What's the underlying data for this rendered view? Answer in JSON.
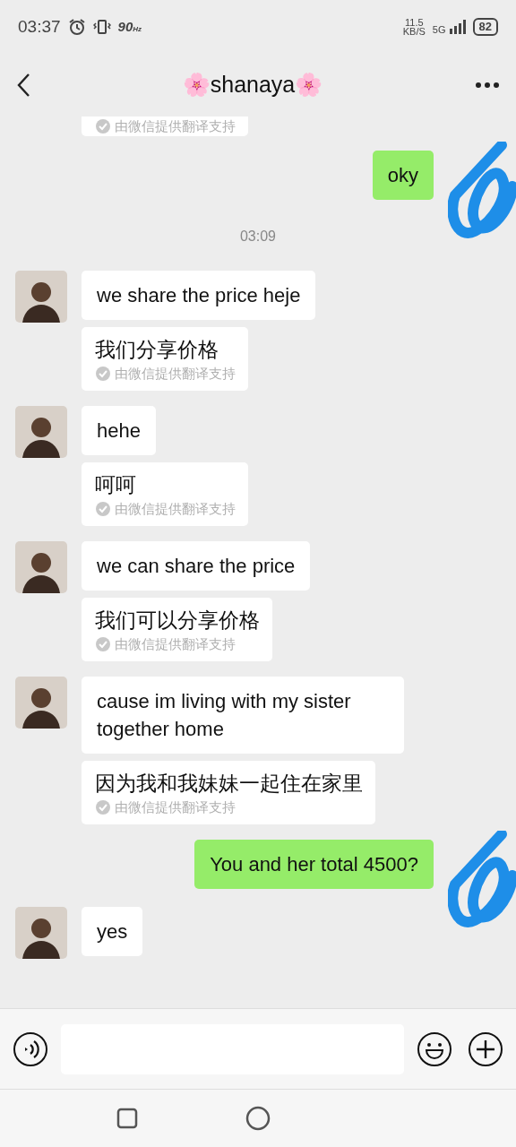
{
  "status_bar": {
    "time": "03:37",
    "refresh_rate": "90",
    "refresh_unit": "Hz",
    "speed": "11.5",
    "speed_unit": "KB/S",
    "network": "5G",
    "battery": "82"
  },
  "header": {
    "title": "🌸shanaya🌸"
  },
  "messages": [
    {
      "kind": "note",
      "note": "由微信提供翻译支持"
    },
    {
      "kind": "sent",
      "text": "oky"
    },
    {
      "kind": "time",
      "text": "03:09"
    },
    {
      "kind": "received",
      "text": "we share the price heje",
      "translation": "我们分享价格",
      "note": "由微信提供翻译支持"
    },
    {
      "kind": "received",
      "text": "hehe",
      "translation": "呵呵",
      "note": "由微信提供翻译支持"
    },
    {
      "kind": "received",
      "text": "we can share the price",
      "translation": "我们可以分享价格",
      "note": "由微信提供翻译支持"
    },
    {
      "kind": "received",
      "text": "cause im living with my sister together home",
      "translation": "因为我和我妹妹一起住在家里",
      "note": "由微信提供翻译支持"
    },
    {
      "kind": "sent",
      "text": "You and her total 4500?"
    },
    {
      "kind": "received",
      "text": "yes"
    }
  ]
}
